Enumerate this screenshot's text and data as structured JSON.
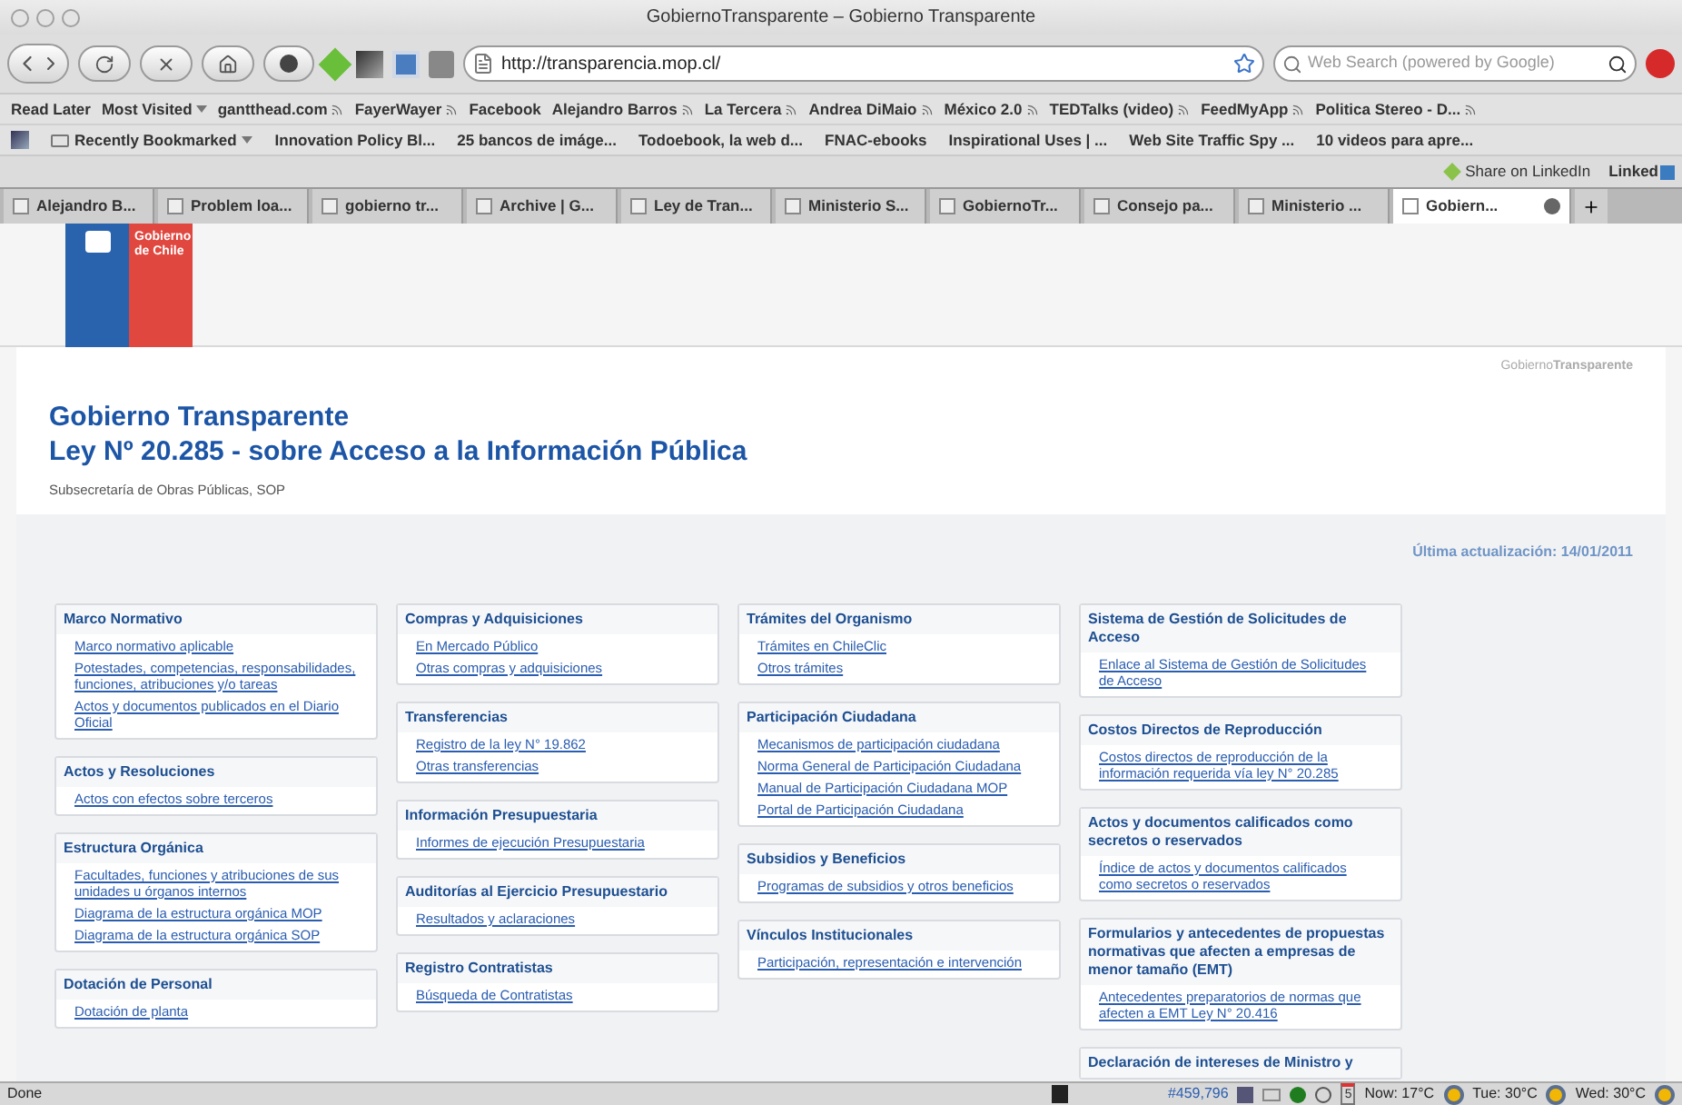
{
  "window": {
    "title": "GobiernoTransparente – Gobierno Transparente"
  },
  "toolbar": {
    "url": "http://transparencia.mop.cl/",
    "search_placeholder": "Web Search (powered by Google)"
  },
  "bookmarks_bar": [
    {
      "label": "Read Later",
      "feed": false,
      "menu": false
    },
    {
      "label": "Most Visited",
      "feed": false,
      "menu": true
    },
    {
      "label": "gantthead.com",
      "feed": true,
      "menu": false
    },
    {
      "label": "FayerWayer",
      "feed": true,
      "menu": false
    },
    {
      "label": "Facebook",
      "feed": false,
      "menu": false
    },
    {
      "label": "Alejandro Barros",
      "feed": true,
      "menu": false
    },
    {
      "label": "La Tercera",
      "feed": true,
      "menu": false
    },
    {
      "label": "Andrea DiMaio",
      "feed": true,
      "menu": false
    },
    {
      "label": "México 2.0",
      "feed": true,
      "menu": false
    },
    {
      "label": "TEDTalks (video)",
      "feed": true,
      "menu": false
    },
    {
      "label": "FeedMyApp",
      "feed": true,
      "menu": false
    },
    {
      "label": "Politica Stereo - D...",
      "feed": true,
      "menu": false
    }
  ],
  "bookmarks_bar_2": [
    {
      "label": "Recently Bookmarked",
      "menu": true
    },
    {
      "label": "Innovation Policy Bl...",
      "menu": false
    },
    {
      "label": "25 bancos de imáge...",
      "menu": false
    },
    {
      "label": "Todoebook, la web d...",
      "menu": false
    },
    {
      "label": "FNAC-ebooks",
      "menu": false
    },
    {
      "label": "Inspirational Uses | ...",
      "menu": false
    },
    {
      "label": "Web Site Traffic Spy ...",
      "menu": false
    },
    {
      "label": "10 videos para apre...",
      "menu": false
    }
  ],
  "addon_bar": {
    "share": "Share on LinkedIn",
    "linkedin": "Linked"
  },
  "tabs": [
    {
      "label": "Alejandro B...",
      "selected": false
    },
    {
      "label": "Problem loa...",
      "selected": false
    },
    {
      "label": "gobierno tr...",
      "selected": false
    },
    {
      "label": "Archive | G...",
      "selected": false
    },
    {
      "label": "Ley de Tran...",
      "selected": false
    },
    {
      "label": "Ministerio S...",
      "selected": false
    },
    {
      "label": "GobiernoTr...",
      "selected": false
    },
    {
      "label": "Consejo pa...",
      "selected": false
    },
    {
      "label": "Ministerio ...",
      "selected": false
    },
    {
      "label": "Gobiern...",
      "selected": true
    }
  ],
  "page": {
    "logo": [
      "Gobierno",
      "de Chile"
    ],
    "brand": "Gobierno**Transparente**",
    "title": "Gobierno Transparente",
    "subtitle": "Ley Nº 20.285 - sobre Acceso a la Información Pública",
    "agency": "Subsecretaría de Obras Públicas, SOP",
    "last_updated": "Última actualización: 14/01/2011",
    "columns": [
      [
        {
          "title": "Marco Normativo",
          "links": [
            "Marco normativo aplicable",
            "Potestades, competencias, responsabilidades, funciones, atribuciones y/o tareas",
            "Actos y documentos publicados en el Diario Oficial"
          ]
        },
        {
          "title": "Actos y Resoluciones",
          "links": [
            "Actos con efectos sobre terceros"
          ]
        },
        {
          "title": "Estructura Orgánica",
          "links": [
            "Facultades, funciones y atribuciones de sus unidades u órganos internos",
            "Diagrama de la estructura orgánica MOP",
            "Diagrama de la estructura orgánica SOP"
          ]
        },
        {
          "title": "Dotación de Personal",
          "links": [
            "Dotación de planta"
          ]
        }
      ],
      [
        {
          "title": "Compras y Adquisiciones",
          "links": [
            "En Mercado Público",
            "Otras compras y adquisiciones"
          ]
        },
        {
          "title": "Transferencias",
          "links": [
            "Registro de la ley N° 19.862",
            "Otras transferencias"
          ]
        },
        {
          "title": "Información Presupuestaria",
          "links": [
            "Informes de ejecución Presupuestaria"
          ]
        },
        {
          "title": "Auditorías al Ejercicio Presupuestario",
          "links": [
            "Resultados y aclaraciones"
          ]
        },
        {
          "title": "Registro Contratistas",
          "links": [
            "Búsqueda de Contratistas"
          ]
        }
      ],
      [
        {
          "title": "Trámites del Organismo",
          "links": [
            "Trámites en ChileClic",
            "Otros trámites"
          ]
        },
        {
          "title": "Participación Ciudadana",
          "links": [
            "Mecanismos de participación ciudadana",
            "Norma General de Participación Ciudadana",
            "Manual de Participación Ciudadana MOP",
            "Portal de Participación Ciudadana"
          ]
        },
        {
          "title": "Subsidios y Beneficios",
          "links": [
            "Programas de subsidios y otros beneficios"
          ]
        },
        {
          "title": "Vínculos Institucionales",
          "links": [
            "Participación, representación e intervención"
          ]
        }
      ],
      [
        {
          "title": "Sistema de Gestión de Solicitudes de Acceso",
          "links": [
            "Enlace al Sistema de Gestión de Solicitudes de Acceso"
          ]
        },
        {
          "title": "Costos Directos de Reproducción",
          "links": [
            "Costos directos de reproducción de la información requerida vía ley N° 20.285"
          ]
        },
        {
          "title": "Actos y documentos calificados como secretos o reservados",
          "links": [
            "Índice de actos y documentos calificados como secretos o reservados"
          ]
        },
        {
          "title": "Formularios y antecedentes de propuestas normativas que afecten a empresas de menor tamaño (EMT)",
          "links": [
            "Antecedentes preparatorios de normas que afecten a EMT Ley N° 20.416"
          ]
        },
        {
          "title": "Declaración de intereses de Ministro y"
        }
      ]
    ]
  },
  "status_bar": {
    "status": "Done",
    "counter": "#459,796",
    "calendar_day": "5",
    "weather": [
      "Now: 17°C",
      "Tue: 30°C",
      "Wed: 30°C"
    ]
  }
}
